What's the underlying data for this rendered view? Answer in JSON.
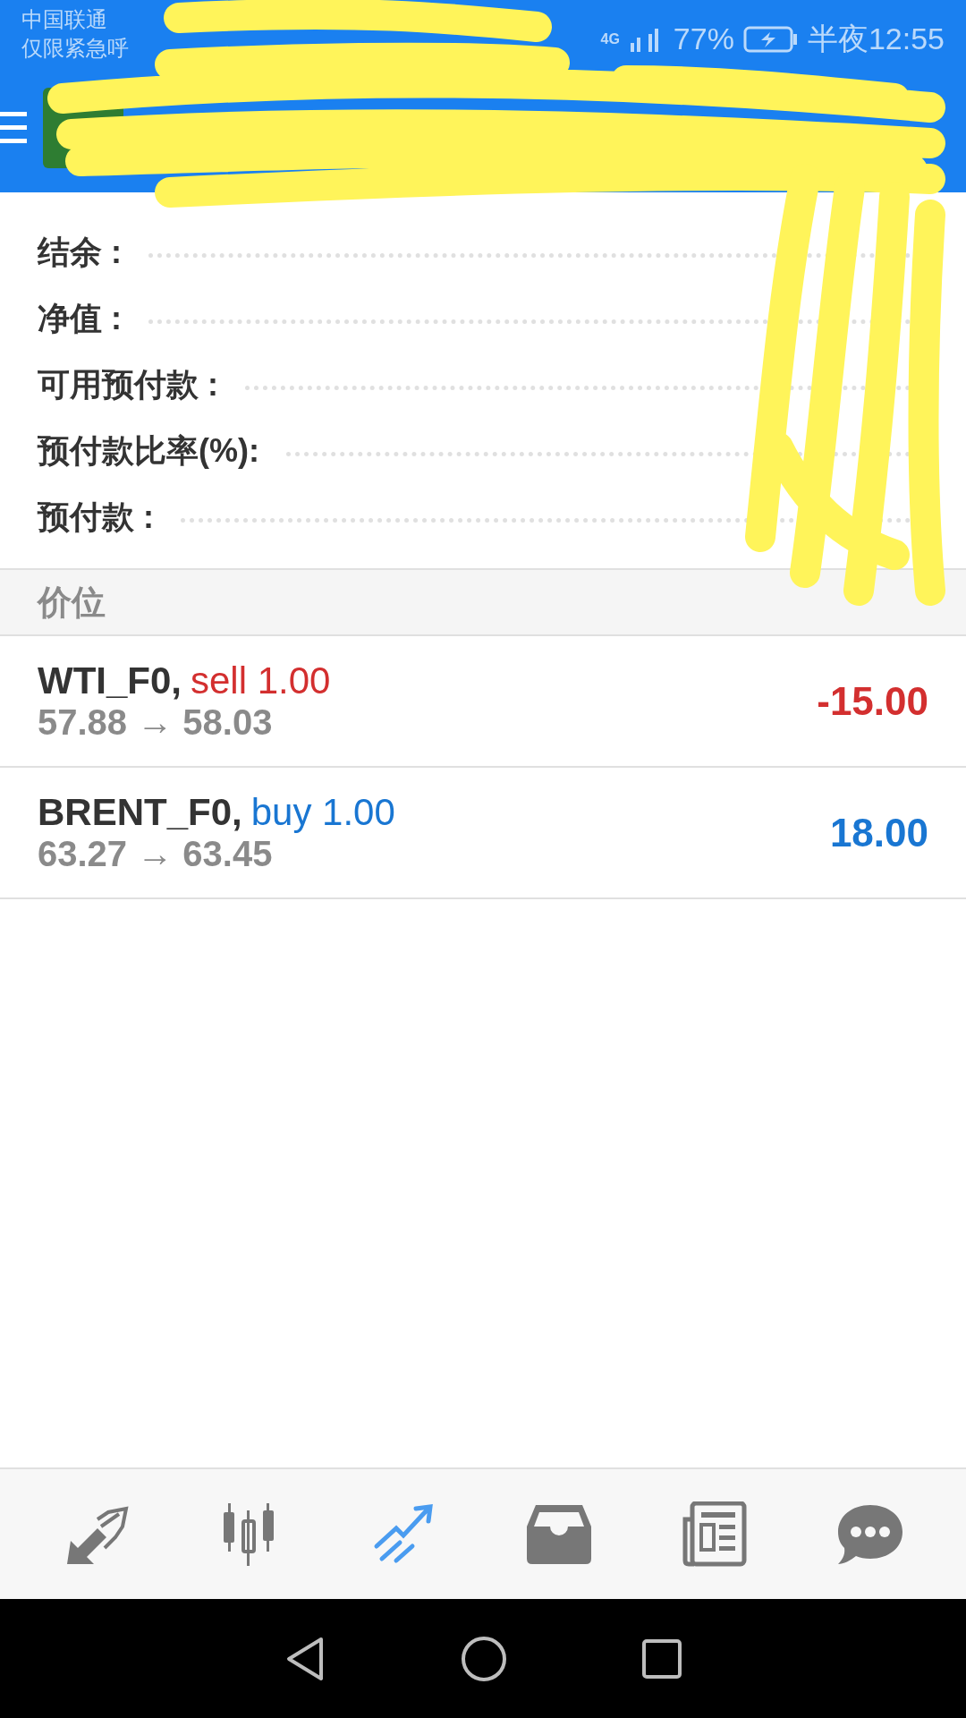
{
  "status_bar": {
    "carrier": "中国联通",
    "carrier_note": "仅限紧急呼",
    "network": "4G",
    "battery": "77%",
    "time": "半夜12:55"
  },
  "summary": [
    {
      "label": "结余 :"
    },
    {
      "label": "净值 :"
    },
    {
      "label": "可用预付款 :"
    },
    {
      "label": "预付款比率(%):"
    },
    {
      "label": "预付款 :"
    }
  ],
  "section": "价位",
  "positions": [
    {
      "symbol": "WTI_F0,",
      "kind": "sell",
      "order": "sell 1.00",
      "prices": "57.88 → 58.03",
      "profit": "-15.00"
    },
    {
      "symbol": "BRENT_F0,",
      "kind": "buy",
      "order": "buy 1.00",
      "prices": "63.27 → 63.45",
      "profit": "18.00"
    }
  ],
  "bottom_tabs": [
    {
      "selected": false
    },
    {
      "selected": false
    },
    {
      "selected": true
    },
    {
      "selected": false
    },
    {
      "selected": false
    },
    {
      "selected": false
    }
  ]
}
